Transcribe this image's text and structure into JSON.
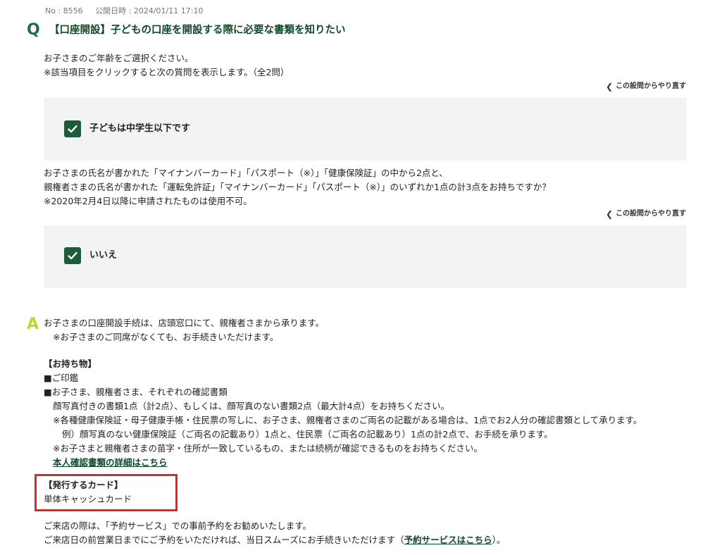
{
  "meta": {
    "no": "No : 8556",
    "published": "公開日時 : 2024/01/11 17:10"
  },
  "question": {
    "mark": "Q",
    "title": "【口座開設】子どもの口座を開設する際に必要な書類を知りたい"
  },
  "step1": {
    "prompt": [
      "お子さまのご年齢をご選択ください。",
      "※該当項目をクリックすると次の質問を表示します。（全2問）"
    ],
    "redo": "この設問からやり直す",
    "answer": "子どもは中学生以下です"
  },
  "step2": {
    "prompt": [
      "お子さまの氏名が書かれた「マイナンバーカード」「パスポート（※）」「健康保険証」の中から2点と、",
      "親権者さまの氏名が書かれた「運転免許証」「マイナンバーカード」「パスポート（※）」のいずれか1点の計3点をお持ちですか？",
      "※2020年2月4日以降に申請されたものは使用不可。"
    ],
    "redo": "この設問からやり直す",
    "answer": "いいえ"
  },
  "answer": {
    "mark": "A",
    "intro": [
      "お子さまの口座開設手続は、店頭窓口にて、親権者さまから承ります。",
      "※お子さまのご同席がなくても、お手続きいただけます。"
    ],
    "items_heading": "【お持ち物】",
    "item1": "■ご印鑑",
    "item2": "■お子さま、親権者さま、それぞれの確認書類",
    "item2_lines": [
      "顔写真付きの書類1点（計2点）、もしくは、顔写真のない書類2点（最大計4点）をお持ちください。",
      "※各種健康保険証・母子健康手帳・住民票の写しに、お子さま、親権者さまのご両名の記載がある場合は、1点でお2人分の確認書類として承ります。",
      "例）顔写真のない健康保険証（ご両名の記載あり）1点と、住民票（ご両名の記載あり）1点の計2点で、お手続を承ります。",
      "※お子さまと親権者さまの苗字・住所が一致しているもの、または続柄が確認できるものをお持ちください。"
    ],
    "id_link": "本人確認書類の詳細はこちら",
    "card_heading": "【発行するカード】",
    "card_value": "単体キャッシュカード",
    "visit_line1": "ご来店の際は、「予約サービス」での事前予約をお勧めいたします。",
    "visit_line2_pre": "ご来店日の前営業日までにご予約をいただければ、当日スムーズにお手続きいただけます（",
    "reservation_link": "予約サービスはこちら",
    "visit_line2_post": "）。"
  },
  "colors": {
    "brand_green": "#1d5c3b",
    "answer_mark": "#c3d42d",
    "highlight": "#d52a2a",
    "panel": "#f1f4f2"
  },
  "icons": {
    "check": "check-icon",
    "chevron": "chevron-left-icon"
  }
}
